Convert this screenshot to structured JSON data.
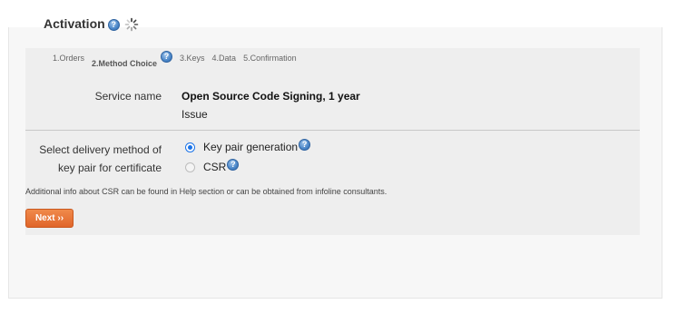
{
  "header": {
    "title": "Activation",
    "help_glyph": "?"
  },
  "steps": [
    {
      "label": "1.Orders",
      "active": false
    },
    {
      "label": "2.Method Choice",
      "active": true
    },
    {
      "label": "3.Keys",
      "active": false
    },
    {
      "label": "4.Data",
      "active": false
    },
    {
      "label": "5.Confirmation",
      "active": false
    }
  ],
  "service": {
    "label": "Service name",
    "value": "Open Source Code Signing, 1 year",
    "sub": "Issue"
  },
  "delivery": {
    "label_line1": "Select delivery method of",
    "label_line2": "key pair for certificate",
    "options": [
      {
        "label": "Key pair generation",
        "selected": true
      },
      {
        "label": "CSR",
        "selected": false
      }
    ]
  },
  "info_text": "Additional info about CSR can be found in Help section or can be obtained from infoline consultants.",
  "next_button": "Next ››",
  "colors": {
    "accent_button": "#e0652a",
    "help_icon": "#4a86c8",
    "radio_selected": "#1a73e8",
    "panel_bg": "#eeeeee"
  }
}
